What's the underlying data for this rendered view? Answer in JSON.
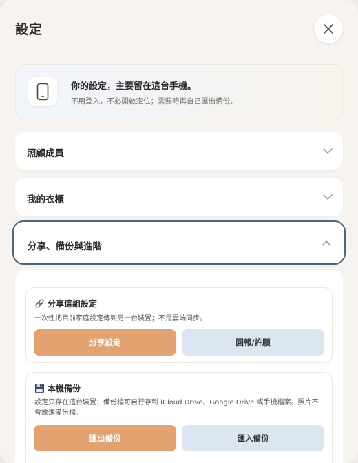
{
  "header": {
    "title": "設定"
  },
  "info": {
    "title": "你的設定，主要留在這台手機。",
    "subtitle": "不用登入，不必開啟定位；需要時再自己匯出備份。"
  },
  "sections": [
    {
      "label": "照顧成員",
      "expanded": false
    },
    {
      "label": "我的衣櫃",
      "expanded": false
    },
    {
      "label": "分享、備份與進階",
      "expanded": true
    }
  ],
  "share_card": {
    "title": "分享這組設定",
    "description": "一次性把目前家庭設定傳到另一台裝置；不是雲端同步。",
    "primary_button": "分享設定",
    "secondary_button": "回報/許願"
  },
  "backup_card": {
    "title": "本機備份",
    "description": "設定只存在這台裝置；備份檔可自行存到 iCloud Drive、Google Drive 或手機檔案。照片不會放進備份檔。",
    "primary_button": "匯出備份",
    "secondary_button": "匯入備份"
  },
  "colors": {
    "accent": "#e3a272",
    "secondary": "#dce6f1",
    "focus_border": "#4b6780",
    "background": "#f7f4ef"
  },
  "icons": {
    "close": "close-icon",
    "phone": "phone-icon",
    "link": "link-icon",
    "save": "floppy-disk-icon",
    "chevron_down": "chevron-down-icon",
    "chevron_up": "chevron-up-icon"
  }
}
